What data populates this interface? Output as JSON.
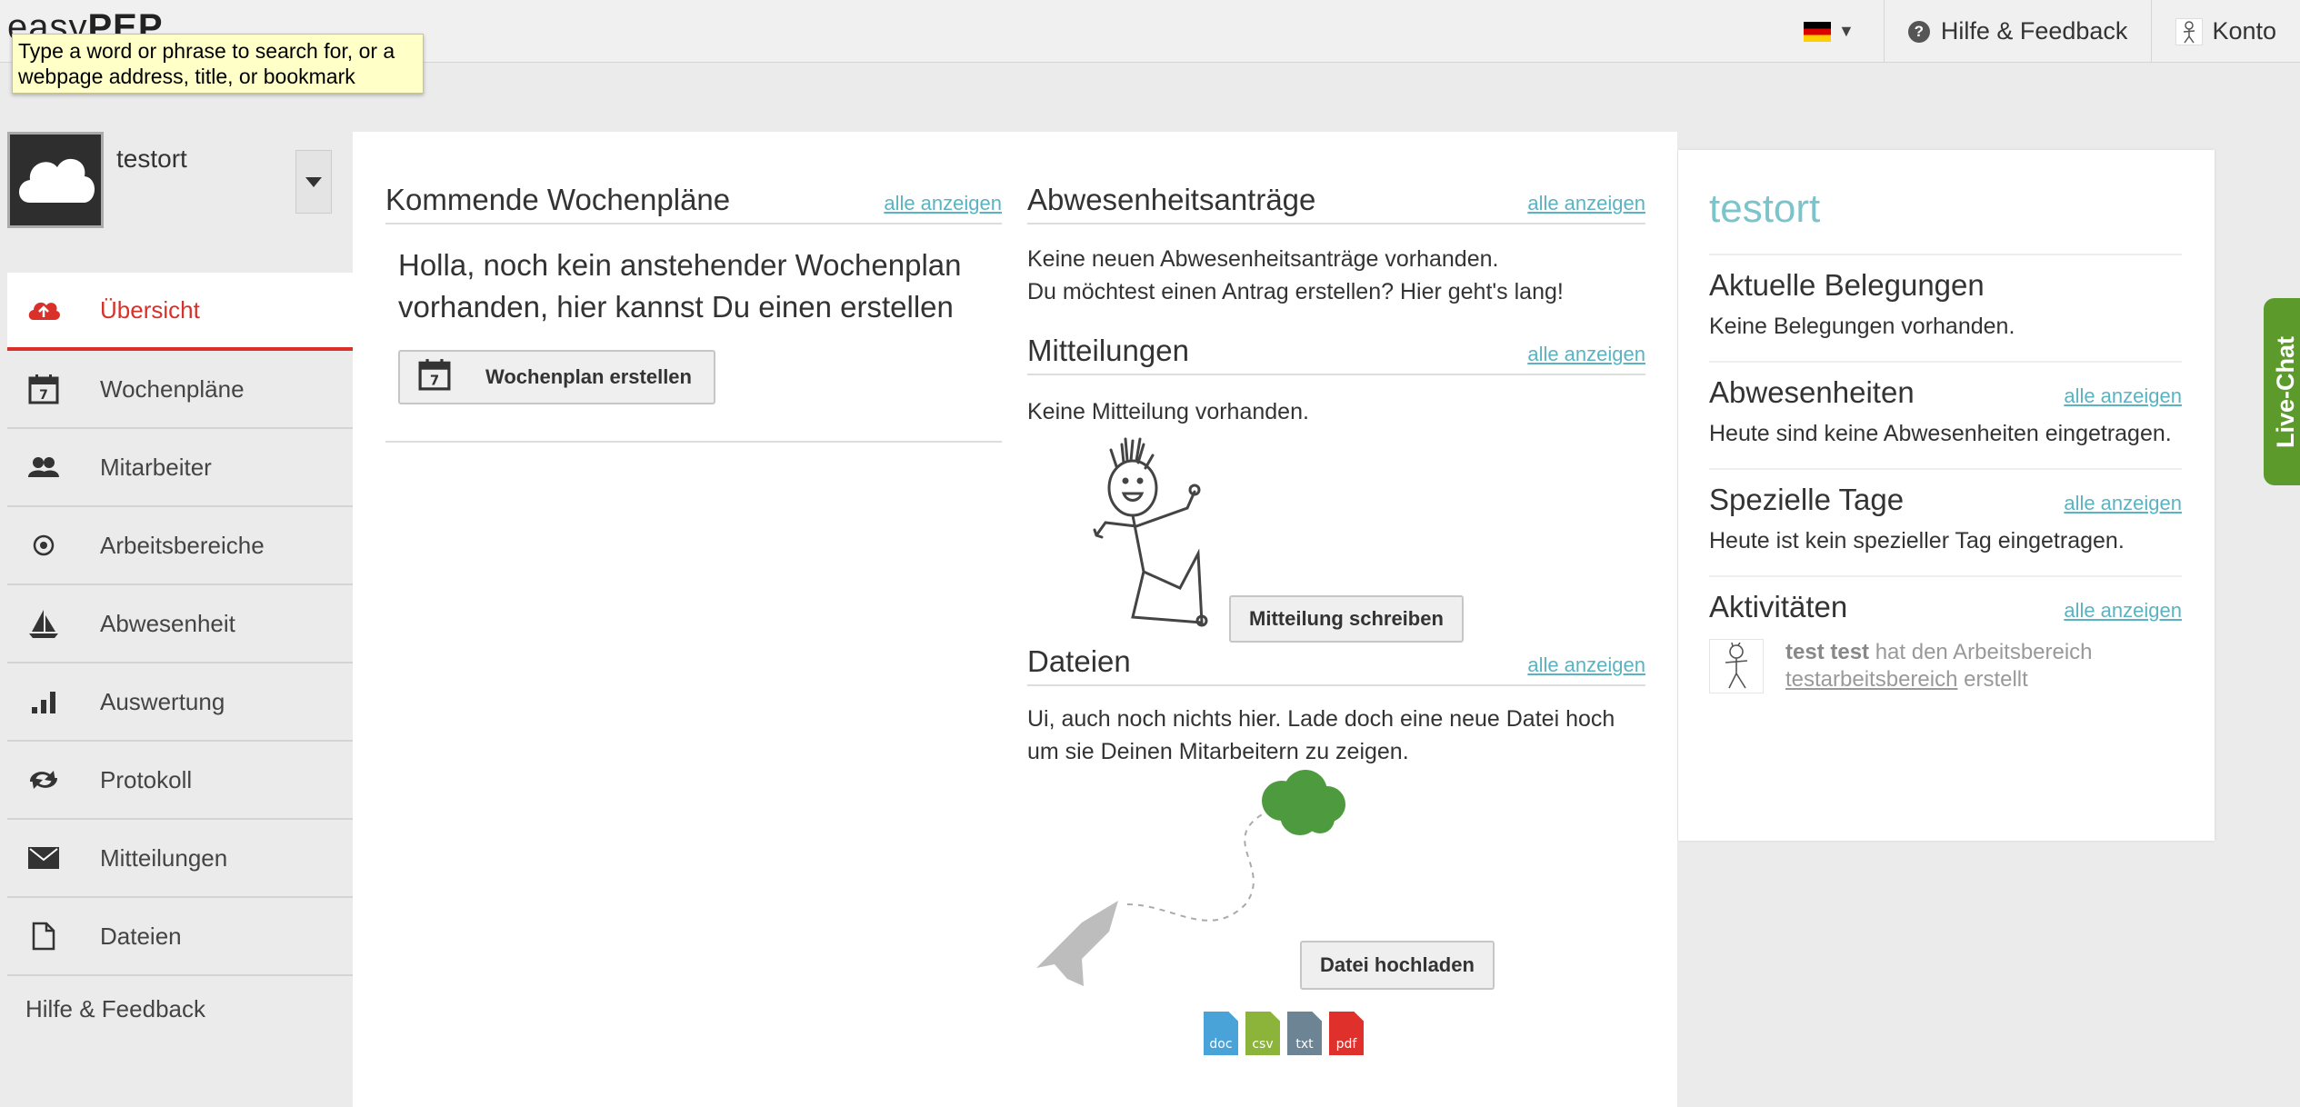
{
  "app": {
    "logo_light": "easy",
    "logo_bold": "PEP"
  },
  "tooltip": "Type a word or phrase to search for, or a webpage address, title, or bookmark",
  "topbar": {
    "help_label": "Hilfe & Feedback",
    "account_label": "Konto"
  },
  "profile": {
    "name": "testort"
  },
  "sidebar": {
    "items": [
      {
        "label": "Übersicht"
      },
      {
        "label": "Wochenpläne"
      },
      {
        "label": "Mitarbeiter"
      },
      {
        "label": "Arbeitsbereiche"
      },
      {
        "label": "Abwesenheit"
      },
      {
        "label": "Auswertung"
      },
      {
        "label": "Protokoll"
      },
      {
        "label": "Mitteilungen"
      },
      {
        "label": "Dateien"
      }
    ],
    "help_label": "Hilfe & Feedback"
  },
  "main": {
    "wochenplaene": {
      "title": "Kommende Wochenpläne",
      "link": "alle anzeigen",
      "message": "Holla, noch kein anstehender Wochenplan vorhanden, hier kannst Du einen erstellen",
      "button": "Wochenplan erstellen"
    },
    "abwesenheitsantraege": {
      "title": "Abwesenheitsanträge",
      "link": "alle anzeigen",
      "line1": "Keine neuen Abwesenheitsanträge vorhanden.",
      "line2": "Du möchtest einen Antrag erstellen? Hier geht's lang!"
    },
    "mitteilungen": {
      "title": "Mitteilungen",
      "link": "alle anzeigen",
      "text": "Keine Mitteilung vorhanden.",
      "button": "Mitteilung schreiben"
    },
    "dateien": {
      "title": "Dateien",
      "link": "alle anzeigen",
      "text": "Ui, auch noch nichts hier. Lade doch eine neue Datei hoch um sie Deinen Mitarbeitern zu zeigen.",
      "button": "Datei hochladen",
      "file_types": [
        "doc",
        "csv",
        "txt",
        "pdf"
      ],
      "file_colors": [
        "#4aa3d8",
        "#8cb33a",
        "#6d8494",
        "#e0302c"
      ]
    }
  },
  "right": {
    "title": "testort",
    "belegungen": {
      "title": "Aktuelle Belegungen",
      "text": "Keine Belegungen vorhanden."
    },
    "abwesenheiten": {
      "title": "Abwesenheiten",
      "link": "alle anzeigen",
      "text": "Heute sind keine Abwesenheiten eingetragen."
    },
    "spezielle_tage": {
      "title": "Spezielle Tage",
      "link": "alle anzeigen",
      "text": "Heute ist kein spezieller Tag eingetragen."
    },
    "aktivitaeten": {
      "title": "Aktivitäten",
      "link": "alle anzeigen",
      "user": "test test",
      "action": "hat den Arbeitsbereich",
      "target": "testarbeitsbereich",
      "verb": "erstellt"
    }
  },
  "livechat": "Live-Chat",
  "colors": {
    "accent_red": "#d9312a",
    "link_teal": "#5bb3c2",
    "title_teal": "#7cc4cb",
    "chat_green": "#5d9a2c"
  }
}
